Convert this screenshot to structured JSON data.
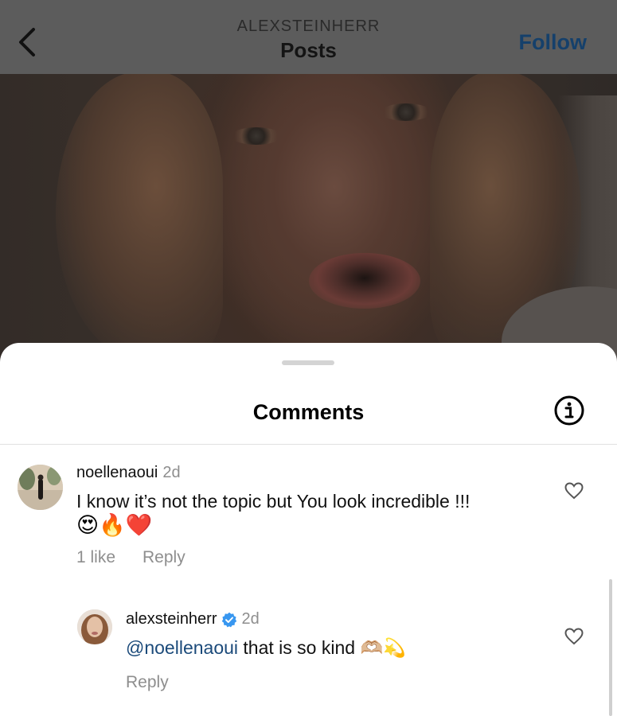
{
  "header": {
    "username": "ALEXSTEINHERR",
    "title": "Posts",
    "follow_label": "Follow",
    "back_icon": "chevron-left-icon"
  },
  "sheet": {
    "title": "Comments",
    "info_icon": "info-icon"
  },
  "comments": [
    {
      "username": "noellenaoui",
      "time": "2d",
      "text": "I know it’s not the topic but You look incredible !!!",
      "emoji": "😍🔥❤️",
      "likes": "1 like",
      "reply_label": "Reply"
    }
  ],
  "replies": [
    {
      "username": "alexsteinherr",
      "verified": true,
      "time": "2d",
      "mention": "@noellenaoui",
      "text": "that is so kind",
      "emoji": "🫶🏼💫",
      "reply_label": "Reply"
    }
  ],
  "colors": {
    "follow": "#15406b",
    "mention": "#1b4a7a",
    "verified": "#3897f0",
    "meta": "#8e8e8e"
  }
}
